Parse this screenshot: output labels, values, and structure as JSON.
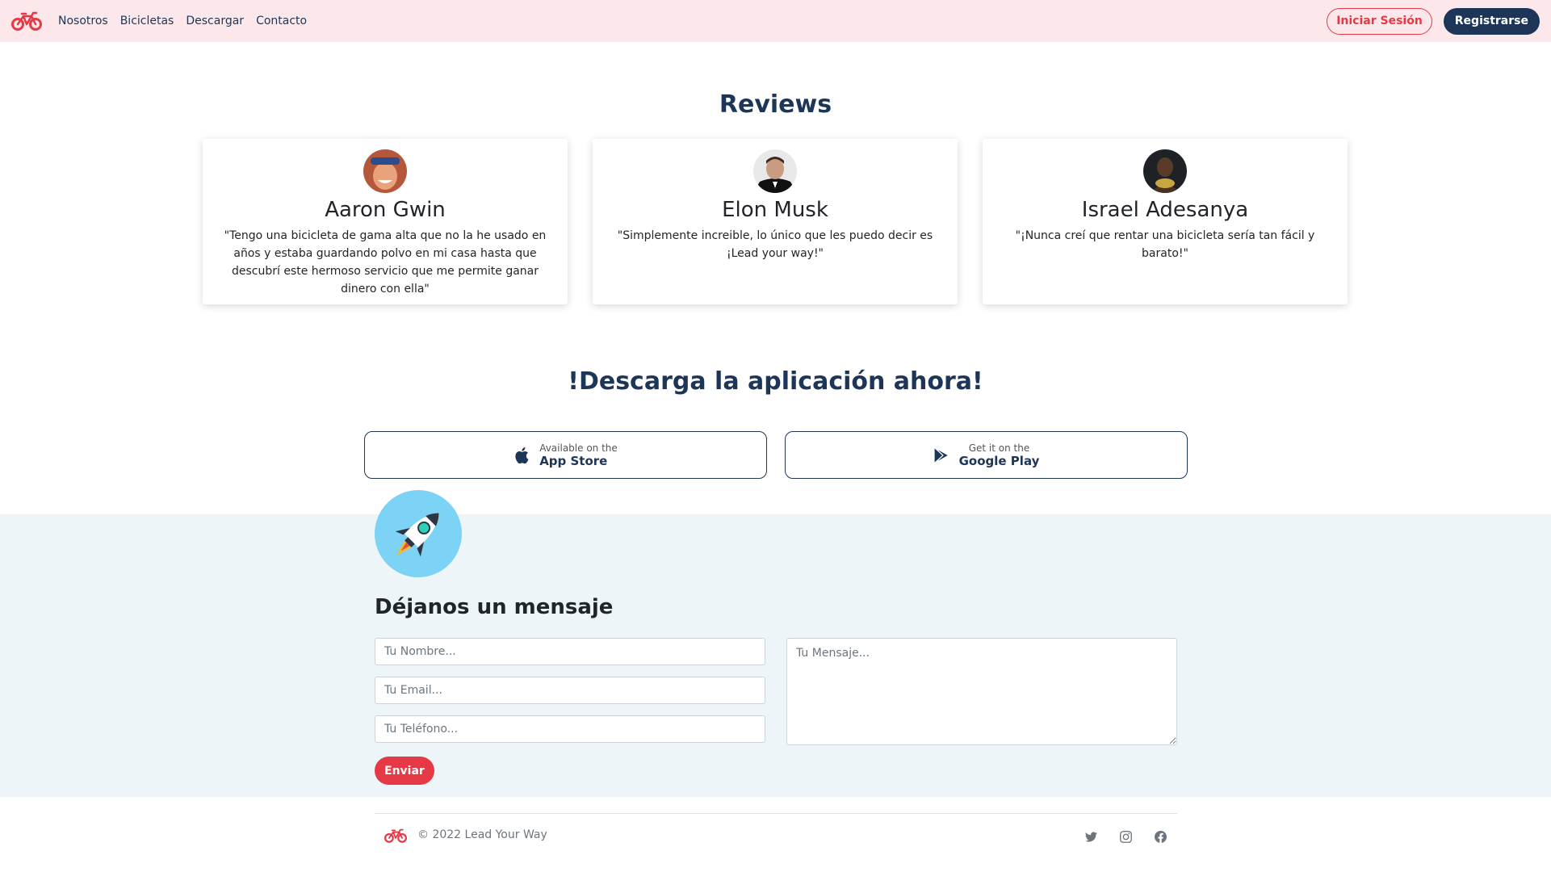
{
  "nav": {
    "brand_icon": "bicycle-icon",
    "links": [
      "Nosotros",
      "Bicicletas",
      "Descargar",
      "Contacto"
    ],
    "login_label": "Iniciar Sesión",
    "register_label": "Registrarse"
  },
  "reviews": {
    "title": "Reviews",
    "items": [
      {
        "name": "Aaron Gwin",
        "text": "\"Tengo una bicicleta de gama alta que no la he usado en años y estaba guardando polvo en mi casa hasta que descubrí este hermoso servicio que me permite ganar dinero con ella\""
      },
      {
        "name": "Elon Musk",
        "text": "\"Simplemente increible, lo único que les puedo decir es ¡Lead your way!\""
      },
      {
        "name": "Israel Adesanya",
        "text": "\"¡Nunca creí que rentar una bicicleta sería tan fácil y barato!\""
      }
    ]
  },
  "download": {
    "title": "!Descarga la aplicación ahora!",
    "app_store": {
      "small": "Available on the",
      "big": "App Store"
    },
    "google_play": {
      "small": "Get it on the",
      "big": "Google Play"
    }
  },
  "contact": {
    "title": "Déjanos un mensaje",
    "name_placeholder": "Tu Nombre...",
    "email_placeholder": "Tu Email...",
    "phone_placeholder": "Tu Teléfono...",
    "message_placeholder": "Tu Mensaje...",
    "send_label": "Enviar"
  },
  "footer": {
    "copyright": "© 2022 Lead Your Way",
    "social_icons": [
      "twitter-icon",
      "instagram-icon",
      "facebook-icon"
    ]
  },
  "colors": {
    "primary": "#1d3557",
    "accent": "#e63946",
    "navbar_bg": "#fce8ea",
    "contact_bg": "#edf5f8"
  }
}
